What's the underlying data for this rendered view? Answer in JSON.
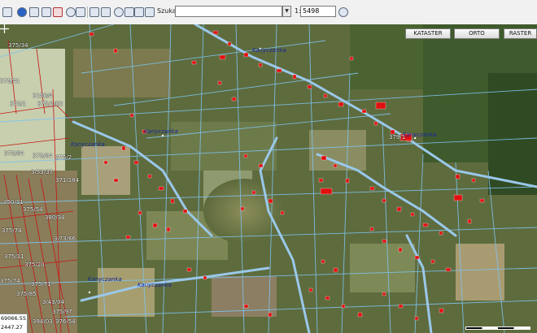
{
  "toolbar": {
    "search_label": "Szukaj:",
    "search_value": "",
    "scale_prefix": "1:",
    "scale_value": "5498"
  },
  "layers": {
    "kataster": "KATASTER",
    "orto": "ORTO",
    "raster": "RASTER"
  },
  "map_labels": {
    "label_1": "Kanyczanka",
    "label_2": "Kanyczanka",
    "label_3": "Kanyczanka",
    "label_4": "Kanyczanka",
    "label_5": "Kanyczanka",
    "label_6": "Kanyczanka"
  },
  "plot_numbers": [
    "375/34",
    "375/41",
    "3150/4",
    "375/1",
    "375/1/02",
    "375/84",
    "375/94",
    "375/2",
    "3/53/37",
    "371/184",
    "350/11",
    "375/54",
    "380/34",
    "375/74",
    "3/73/66",
    "375/11",
    "375/20",
    "375/74",
    "375/71",
    "375/85",
    "3/43/04",
    "375/97",
    "394/03",
    "376/54",
    "379/1"
  ],
  "status": {
    "coord_x": "69066.55",
    "coord_y": "2447.27"
  },
  "colors": {
    "toolbar_bg": "#f1f1f1",
    "parcel_lines": "#7fc4ee",
    "buildings": "#e01010",
    "cadastre_red": "#c81414",
    "vegetation": "#5c6b3c"
  }
}
